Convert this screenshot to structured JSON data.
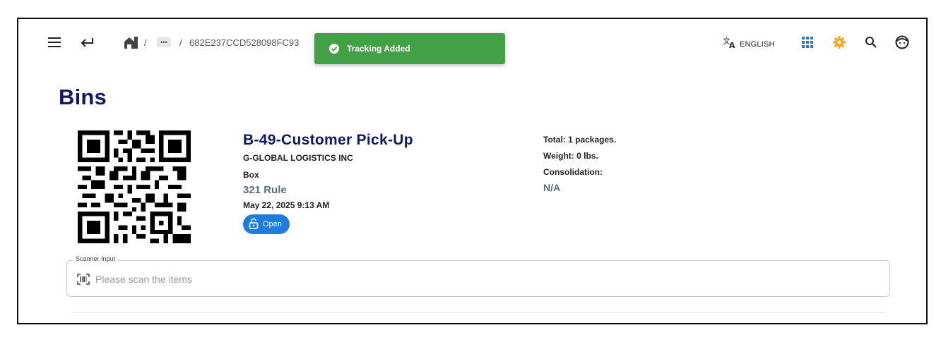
{
  "breadcrumb": {
    "separator": "/",
    "more": "•••",
    "current_id": "682E237CCD528098FC93"
  },
  "toast": {
    "message": "Tracking Added",
    "color": "#43a047"
  },
  "header": {
    "language": "ENGLISH"
  },
  "page": {
    "title": "Bins"
  },
  "bin": {
    "name": "B-49-Customer Pick-Up",
    "company": "G-GLOBAL LOGISTICS INC",
    "type": "Box",
    "rule": "321 Rule",
    "date": "May 22, 2025 9:13 AM",
    "status": "Open"
  },
  "stats": {
    "total": "Total: 1 packages.",
    "weight": "Weight: 0 lbs.",
    "consolidation_label": "Consolidation:",
    "consolidation_value": "N/A"
  },
  "scanner": {
    "label": "Scanner Input",
    "placeholder": "Please scan the items"
  },
  "colors": {
    "title": "#0d1a6b",
    "accent_blue": "#1e7be0",
    "apps_icon": "#1e7be0",
    "gear_icon": "#f5a623",
    "muted": "#5b6b85"
  },
  "icons": [
    "menu-icon",
    "back-arrow-icon",
    "home-icon",
    "translate-icon",
    "apps-grid-icon",
    "gear-icon",
    "search-icon",
    "avatar-icon",
    "check-circle-icon",
    "qr-code",
    "unlock-icon",
    "barcode-scan-icon"
  ]
}
